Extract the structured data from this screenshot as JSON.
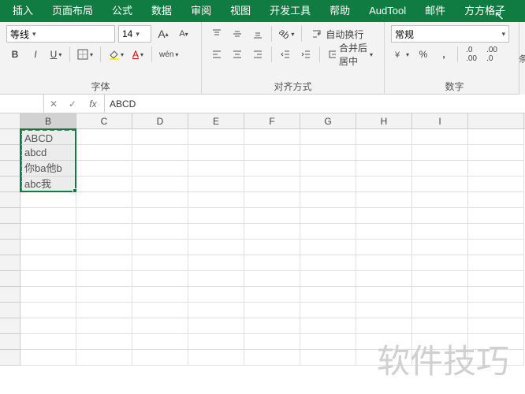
{
  "menu": {
    "tabs": [
      "插入",
      "页面布局",
      "公式",
      "数据",
      "审阅",
      "视图",
      "开发工具",
      "帮助",
      "AudTool",
      "邮件",
      "方方格子"
    ]
  },
  "ribbon": {
    "font_group_label": "字体",
    "align_group_label": "对齐方式",
    "number_group_label": "数字",
    "font_name": "等线",
    "font_size": "14",
    "increase_font": "A",
    "decrease_font": "A",
    "bold": "B",
    "italic": "I",
    "underline": "U",
    "wen": "wén",
    "wrap_text": "自动换行",
    "merge_center": "合并后居中",
    "number_format": "常规",
    "right_label": "条"
  },
  "formula_bar": {
    "name_box": "",
    "cancel": "✕",
    "confirm": "✓",
    "fx": "fx",
    "value": "ABCD"
  },
  "grid": {
    "cols": [
      "B",
      "C",
      "D",
      "E",
      "F",
      "G",
      "H",
      "I",
      ""
    ],
    "selected_col": "B",
    "data": {
      "B": [
        "ABCD",
        "abcd",
        "你ba他b",
        "abc我"
      ]
    }
  },
  "watermark": "软件技巧"
}
